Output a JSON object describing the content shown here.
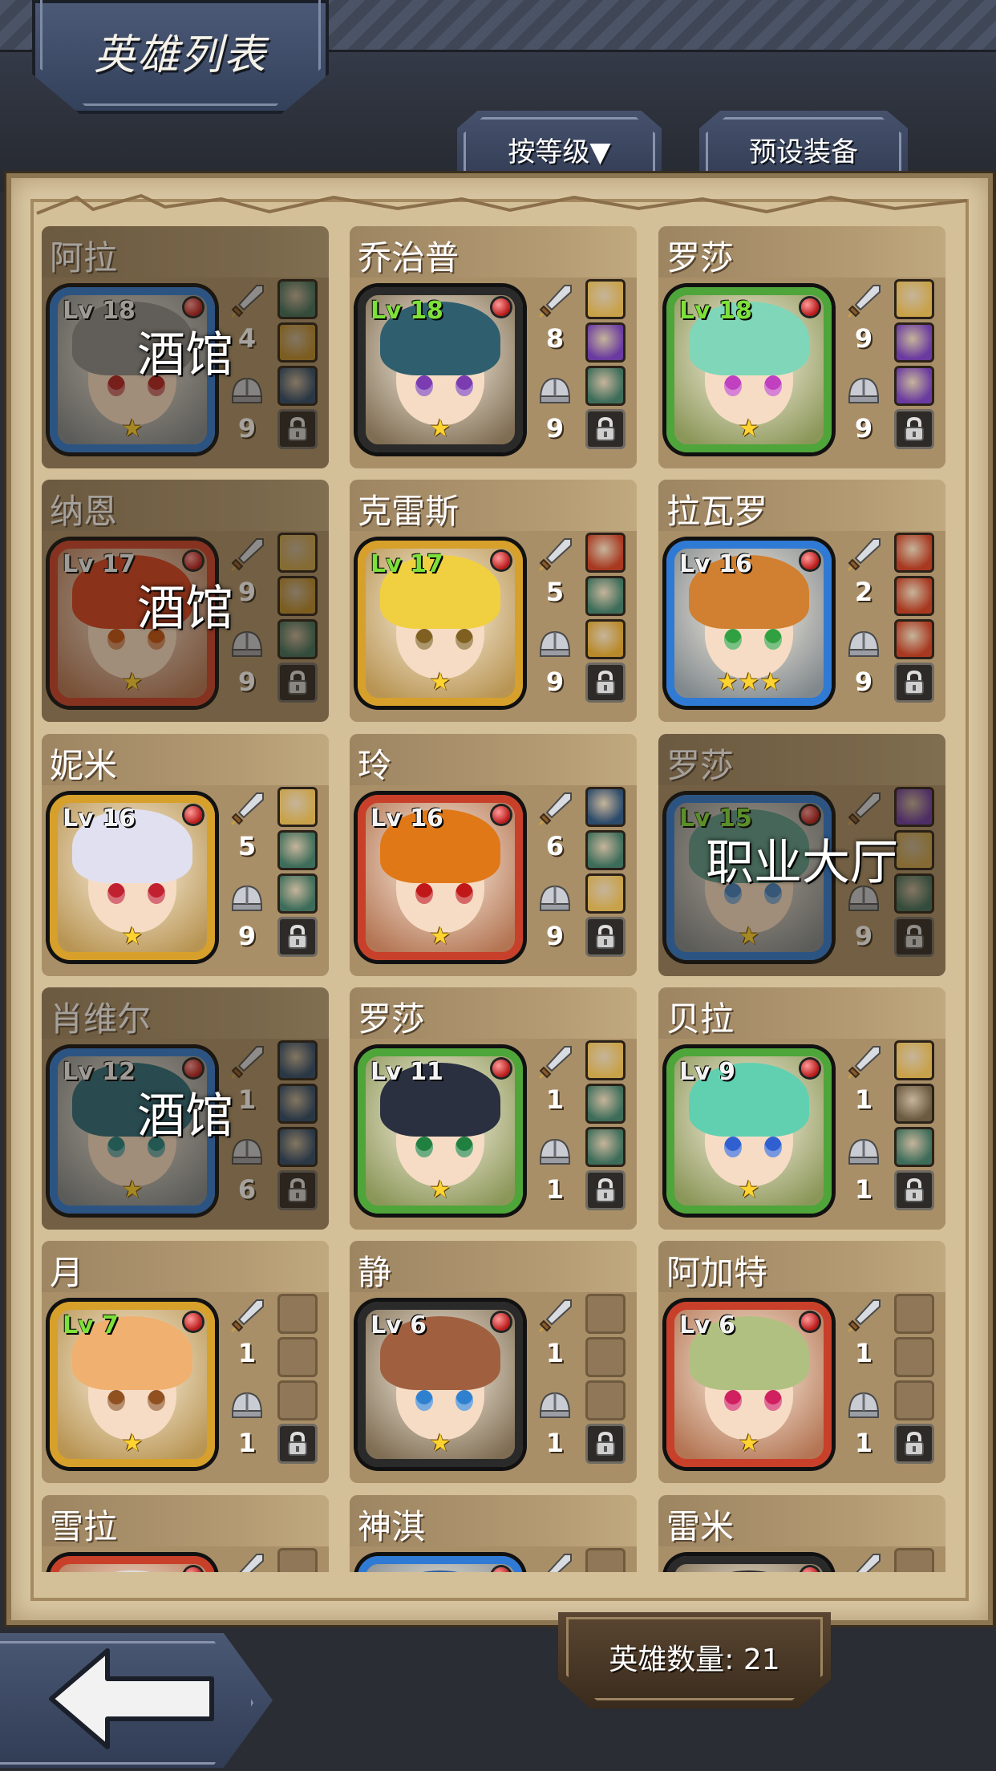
{
  "header": {
    "title": "英雄列表"
  },
  "tabs": {
    "sort_label": "按等级▼",
    "preset_label": "预设装备"
  },
  "footer": {
    "hero_count": "英雄数量: 21"
  },
  "heroes": [
    {
      "name": "阿拉",
      "level": "Lv 18",
      "frame": "blue",
      "weapon": "4",
      "armor": "9",
      "stars": "★",
      "overlay": "酒馆",
      "level_color": "white",
      "hair": "#8a8a8a",
      "eye": "#b02020"
    },
    {
      "name": "乔治普",
      "level": "Lv 18",
      "frame": "black",
      "weapon": "8",
      "armor": "9",
      "stars": "★",
      "overlay": "",
      "level_color": "green",
      "hair": "#2f5f6f",
      "eye": "#7a3cb0"
    },
    {
      "name": "罗莎",
      "level": "Lv 18",
      "frame": "green",
      "weapon": "9",
      "armor": "9",
      "stars": "★",
      "overlay": "",
      "level_color": "green",
      "hair": "#7fd6b8",
      "eye": "#c040c0"
    },
    {
      "name": "纳恩",
      "level": "Lv 17",
      "frame": "red",
      "weapon": "9",
      "armor": "9",
      "stars": "★",
      "overlay": "酒馆",
      "level_color": "white",
      "hair": "#d04020",
      "eye": "#c05010"
    },
    {
      "name": "克雷斯",
      "level": "Lv 17",
      "frame": "gold",
      "weapon": "5",
      "armor": "9",
      "stars": "★",
      "overlay": "",
      "level_color": "green",
      "hair": "#f0d040",
      "eye": "#806020"
    },
    {
      "name": "拉瓦罗",
      "level": "Lv 16",
      "frame": "blue",
      "weapon": "2",
      "armor": "9",
      "stars": "★★★",
      "overlay": "",
      "level_color": "white",
      "hair": "#d08030",
      "eye": "#30a040"
    },
    {
      "name": "妮米",
      "level": "Lv 16",
      "frame": "gold",
      "weapon": "5",
      "armor": "9",
      "stars": "★",
      "overlay": "",
      "level_color": "white",
      "hair": "#e0e0f0",
      "eye": "#c02030"
    },
    {
      "name": "玲",
      "level": "Lv 16",
      "frame": "red",
      "weapon": "6",
      "armor": "9",
      "stars": "★",
      "overlay": "",
      "level_color": "white",
      "hair": "#e07818",
      "eye": "#c01818"
    },
    {
      "name": "罗莎",
      "level": "Lv 15",
      "frame": "blue",
      "weapon": "",
      "armor": "9",
      "stars": "★",
      "overlay": "职业大厅",
      "level_color": "green",
      "hair": "#5a9a8a",
      "eye": "#4080c0"
    },
    {
      "name": "肖维尔",
      "level": "Lv 12",
      "frame": "blue",
      "weapon": "1",
      "armor": "6",
      "stars": "★",
      "overlay": "酒馆",
      "level_color": "white",
      "hair": "#2a6a7a",
      "eye": "#208080"
    },
    {
      "name": "罗莎",
      "level": "Lv 11",
      "frame": "green",
      "weapon": "1",
      "armor": "1",
      "stars": "★",
      "overlay": "",
      "level_color": "white",
      "hair": "#2a3040",
      "eye": "#208040"
    },
    {
      "name": "贝拉",
      "level": "Lv 9",
      "frame": "green",
      "weapon": "1",
      "armor": "1",
      "stars": "★",
      "overlay": "",
      "level_color": "white",
      "hair": "#60d0b0",
      "eye": "#3060d0"
    },
    {
      "name": "月",
      "level": "Lv 7",
      "frame": "gold",
      "weapon": "1",
      "armor": "1",
      "stars": "★",
      "overlay": "",
      "level_color": "green",
      "hair": "#f0b070",
      "eye": "#905020"
    },
    {
      "name": "静",
      "level": "Lv 6",
      "frame": "black",
      "weapon": "1",
      "armor": "1",
      "stars": "★",
      "overlay": "",
      "level_color": "white",
      "hair": "#a06040",
      "eye": "#3080d0"
    },
    {
      "name": "阿加特",
      "level": "Lv 6",
      "frame": "red",
      "weapon": "1",
      "armor": "1",
      "stars": "★",
      "overlay": "",
      "level_color": "white",
      "hair": "#b0c080",
      "eye": "#d02060"
    },
    {
      "name": "雪拉",
      "level": "",
      "frame": "red",
      "weapon": "",
      "armor": "",
      "stars": "",
      "overlay": "",
      "level_color": "white",
      "hair": "#e0e0e0",
      "eye": "#333333"
    },
    {
      "name": "神淇",
      "level": "",
      "frame": "blue",
      "weapon": "",
      "armor": "",
      "stars": "",
      "overlay": "",
      "level_color": "white",
      "hair": "#3060a0",
      "eye": "#333333"
    },
    {
      "name": "雷米",
      "level": "",
      "frame": "black",
      "weapon": "",
      "armor": "",
      "stars": "",
      "overlay": "",
      "level_color": "white",
      "hair": "#303030",
      "eye": "#333333"
    }
  ],
  "slot_sets": [
    [
      "#3d6d5a",
      "#b98a2a",
      "#2c4a6a",
      "lock"
    ],
    [
      "#c8a24a",
      "#6a3aa0",
      "#3d6d5a",
      "lock"
    ],
    [
      "#c8a24a",
      "#6a3aa0",
      "#6a3aa0",
      "lock"
    ],
    [
      "#c8a24a",
      "#b98a2a",
      "#3d6d5a",
      "lock"
    ],
    [
      "#a83820",
      "#3d6d5a",
      "#b98a2a",
      "lock"
    ],
    [
      "#a83820",
      "#a83820",
      "#a83820",
      "lock"
    ],
    [
      "#c8a24a",
      "#3d6d5a",
      "#3d6d5a",
      "lock"
    ],
    [
      "#2c4a6a",
      "#3d6d5a",
      "#c8a24a",
      "lock"
    ],
    [
      "#6a3aa0",
      "#c8a24a",
      "#3d6d5a",
      "lock"
    ],
    [
      "#2c4a6a",
      "#2c4a6a",
      "#2c4a6a",
      "lock"
    ],
    [
      "#c8a24a",
      "#3d6d5a",
      "#3d6d5a",
      "lock"
    ],
    [
      "#c8a24a",
      "#6a5a40",
      "#3d6d5a",
      "lock"
    ],
    [
      "empty",
      "empty",
      "empty",
      "lock"
    ],
    [
      "empty",
      "empty",
      "empty",
      "lock"
    ],
    [
      "empty",
      "empty",
      "empty",
      "lock"
    ],
    [
      "empty",
      "empty",
      "empty",
      "lock"
    ],
    [
      "empty",
      "empty",
      "empty",
      "lock"
    ],
    [
      "empty",
      "empty",
      "empty",
      "lock"
    ]
  ],
  "colors": {
    "frame_blue": "#2f7ad4",
    "frame_green": "#4ea53a",
    "frame_red": "#c8402a",
    "frame_gold": "#d6a02a",
    "frame_black": "#2a2a2a"
  }
}
